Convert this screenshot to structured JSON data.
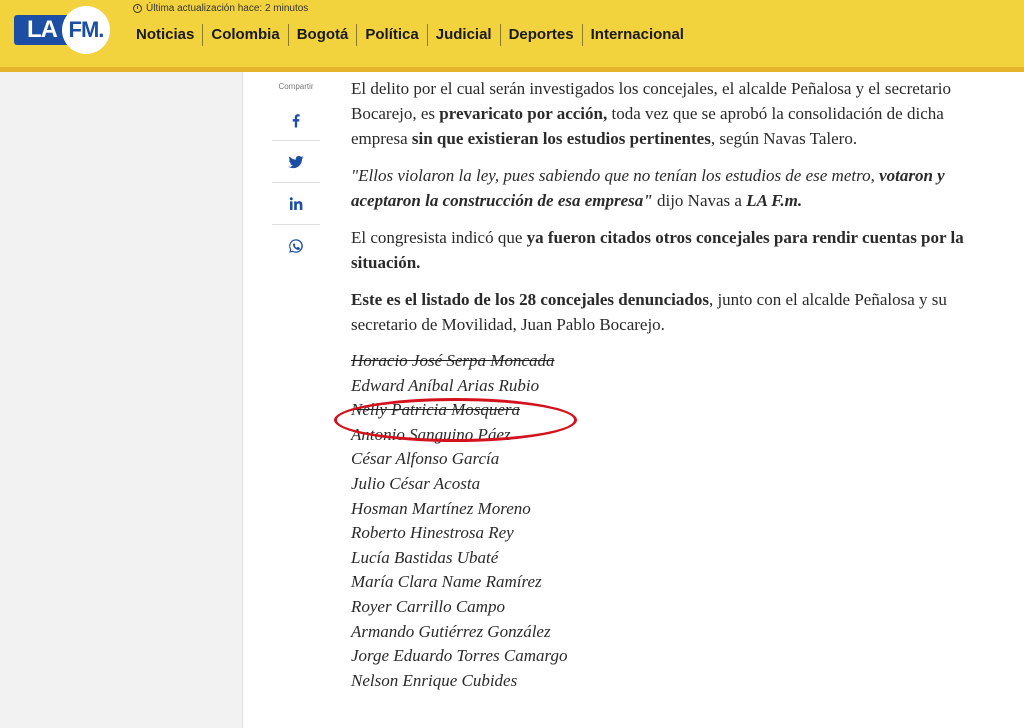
{
  "header": {
    "logo_la": "LA",
    "logo_fm": "FM.",
    "update_text": "Última actualización hace: 2 minutos",
    "nav": [
      "Noticias",
      "Colombia",
      "Bogotá",
      "Política",
      "Judicial",
      "Deportes",
      "Internacional"
    ],
    "bg_color": "#f2d33d",
    "logo_color": "#1c4fa3"
  },
  "share": {
    "label": "Compartir",
    "icons": [
      "facebook-icon",
      "twitter-icon",
      "linkedin-icon",
      "whatsapp-icon"
    ]
  },
  "article": {
    "p1": {
      "a": "El delito por el cual serán investigados los concejales, el alcalde Peñalosa y el secretario Bocarejo, es ",
      "b": "prevaricato por acción,",
      "c": " toda vez que se aprobó la consolidación de dicha empresa ",
      "d": "sin que existieran los estudios pertinentes",
      "e": ", según Navas Talero."
    },
    "p2": {
      "a": "\"Ellos violaron la ley, pues sabiendo que no tenían los estudios de ese metro, ",
      "b": "votaron y aceptaron la construcción de esa empresa\"",
      "c": " dijo Navas a ",
      "d": "LA F.m."
    },
    "p3": {
      "a": "El congresista indicó que ",
      "b": "ya fueron citados otros concejales para rendir cuentas por la situación."
    },
    "p4": {
      "a": "Este es el listado de los 28 concejales denunciados",
      "b": ", junto con el alcalde Peñalosa y su secretario de Movilidad, Juan Pablo Bocarejo."
    },
    "names": [
      "Horacio José Serpa Moncada",
      "Edward Aníbal Arias Rubio",
      "Nelly Patricia Mosquera",
      "Antonio Sanguino Páez",
      "César Alfonso García",
      "Julio César Acosta",
      "Hosman Martínez Moreno",
      "Roberto Hinestrosa Rey",
      "Lucía Bastidas Ubaté",
      "María Clara Name Ramírez",
      "Royer Carrillo Campo",
      "Armando Gutiérrez González",
      "Jorge Eduardo Torres Camargo",
      "Nelson Enrique Cubides"
    ],
    "highlight_color": "#d4121d"
  }
}
